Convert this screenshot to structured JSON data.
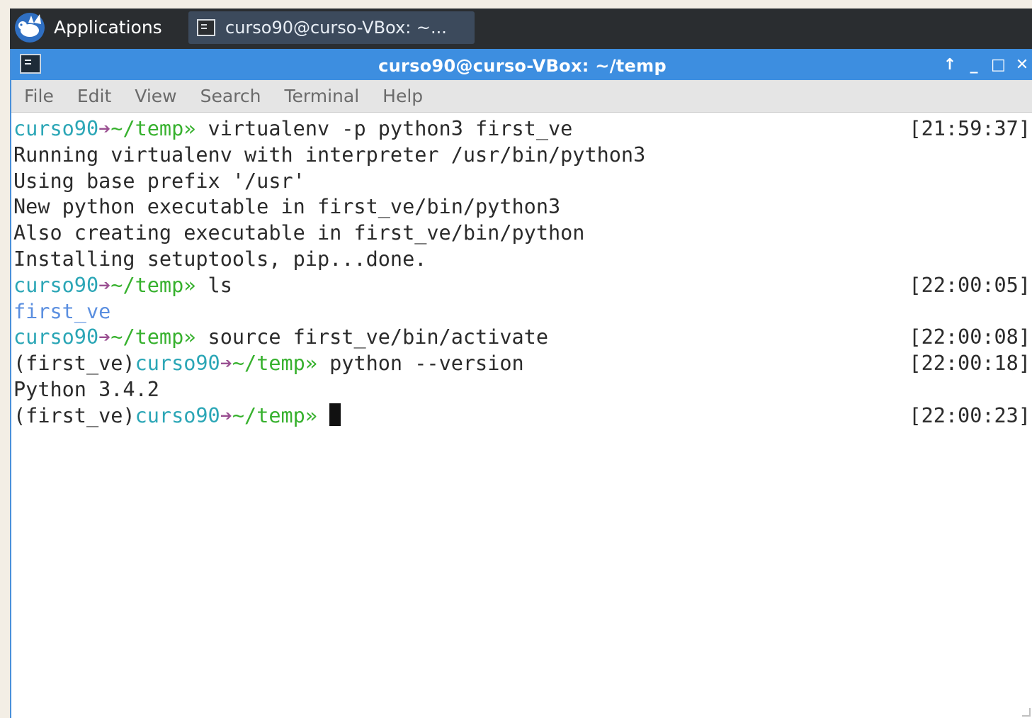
{
  "panel": {
    "applications_label": "Applications",
    "task_label": "curso90@curso-VBox: ~..."
  },
  "window": {
    "title": "curso90@curso-VBox: ~/temp",
    "controls": {
      "shade": "↑",
      "minimize": "_",
      "maximize": "□",
      "close": "✕"
    }
  },
  "menu": [
    "File",
    "Edit",
    "View",
    "Search",
    "Terminal",
    "Help"
  ],
  "terminal": {
    "prompt_user": "curso90",
    "prompt_arrow": "➔",
    "prompt_path": "~/temp»",
    "venv_prefix": "(first_ve)",
    "lines": [
      {
        "cmd": " virtualenv -p python3 first_ve",
        "time": "[21:59:37]"
      },
      {
        "out": "Running virtualenv with interpreter /usr/bin/python3"
      },
      {
        "out": "Using base prefix '/usr'"
      },
      {
        "out": "New python executable in first_ve/bin/python3"
      },
      {
        "out": "Also creating executable in first_ve/bin/python"
      },
      {
        "out": "Installing setuptools, pip...done."
      },
      {
        "cmd": " ls",
        "time": "[22:00:05]"
      },
      {
        "dir": "first_ve"
      },
      {
        "cmd": " source first_ve/bin/activate",
        "time": "[22:00:08]"
      },
      {
        "venv_cmd": " python --version",
        "time": "[22:00:18]"
      },
      {
        "out": "Python 3.4.2"
      },
      {
        "venv_cmd": " ",
        "time": "[22:00:23]"
      }
    ]
  }
}
